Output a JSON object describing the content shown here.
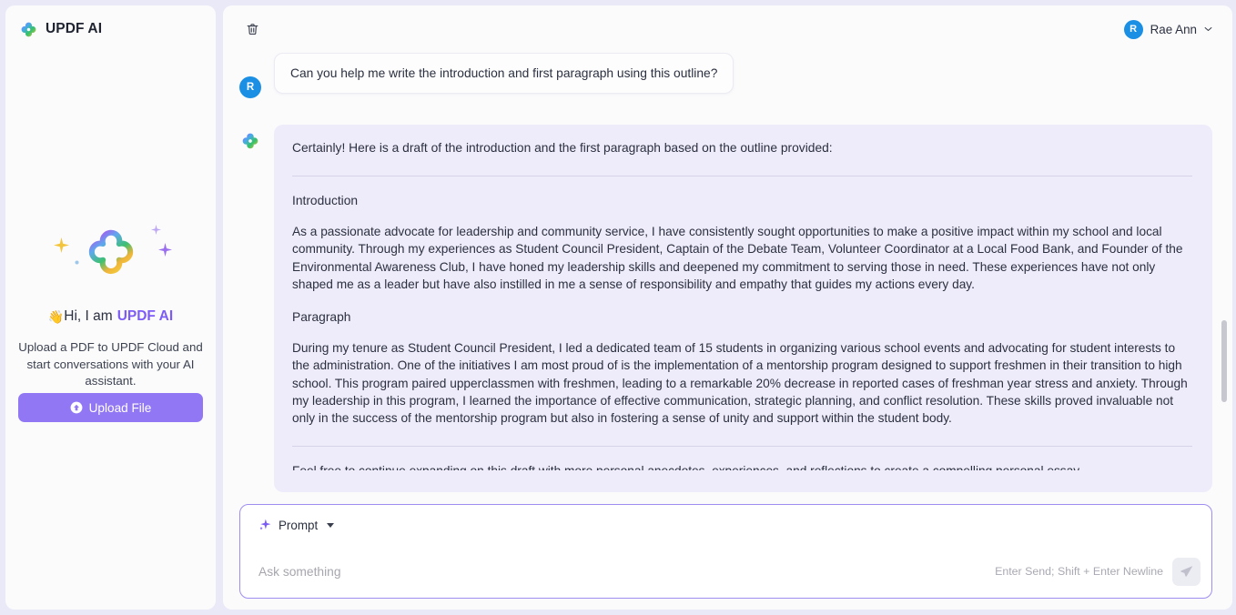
{
  "sidebar": {
    "brand_title": "UPDF AI",
    "logo_icon": "updf-clover-logo",
    "hero": {
      "logo_icon": "updf-clover-logo-large",
      "sparkle_icons": [
        "sparkle-yellow",
        "sparkle-purple",
        "sparkle-small-purple",
        "sparkle-dot-blue"
      ],
      "wave_emoji": "👋",
      "greeting_prefix": "Hi, I am",
      "greeting_brand": "UPDF AI",
      "subtitle": "Upload a PDF to UPDF Cloud and start conversations with your AI assistant."
    },
    "upload_button": {
      "label": "Upload File",
      "icon": "upload-circle-arrow-icon",
      "color": "#9277f5"
    }
  },
  "topbar": {
    "delete_icon": "trash-icon",
    "user": {
      "avatar_initial": "R",
      "avatar_color": "#1b8fe3",
      "name": "Rae Ann",
      "chevron_icon": "chevron-down-icon"
    }
  },
  "conversation": {
    "user_message": {
      "avatar_initial": "R",
      "text": "Can you help me write the introduction and first paragraph using this outline?"
    },
    "ai_message": {
      "avatar_icon": "updf-clover-logo",
      "lead": "Certainly! Here is a draft of the introduction and the first paragraph based on the outline provided:",
      "section_1_heading": "Introduction",
      "section_1_body": "As a passionate advocate for leadership and community service, I have consistently sought opportunities to make a positive impact within my school and local community. Through my experiences as Student Council President, Captain of the Debate Team, Volunteer Coordinator at a Local Food Bank, and Founder of the Environmental Awareness Club, I have honed my leadership skills and deepened my commitment to serving those in need. These experiences have not only shaped me as a leader but have also instilled in me a sense of responsibility and empathy that guides my actions every day.",
      "section_2_heading": "Paragraph",
      "section_2_body": "During my tenure as Student Council President, I led a dedicated team of 15 students in organizing various school events and advocating for student interests to the administration. One of the initiatives I am most proud of is the implementation of a mentorship program designed to support freshmen in their transition to high school. This program paired upperclassmen with freshmen, leading to a remarkable 20% decrease in reported cases of freshman year stress and anxiety. Through my leadership in this program, I learned the importance of effective communication, strategic planning, and conflict resolution. These skills proved invaluable not only in the success of the mentorship program but also in fostering a sense of unity and support within the student body.",
      "clipped_line": "Feel free to continue expanding on this draft with more personal anecdotes, experiences, and reflections to create a compelling personal essay."
    }
  },
  "composer": {
    "prompt_chip": {
      "icon": "sparkle-icon",
      "label": "Prompt",
      "caret_icon": "caret-down-icon"
    },
    "input": {
      "value": "",
      "placeholder": "Ask something"
    },
    "hint": "Enter Send; Shift + Enter Newline",
    "send_button": {
      "icon": "send-plane-icon",
      "enabled": false
    }
  },
  "theme": {
    "page_bg": "#e9e9f7",
    "panel_bg": "#fbfbfc",
    "ai_bubble_bg": "#eeecfa",
    "accent_purple": "#7d5cf6",
    "avatar_blue": "#1b8fe3"
  }
}
